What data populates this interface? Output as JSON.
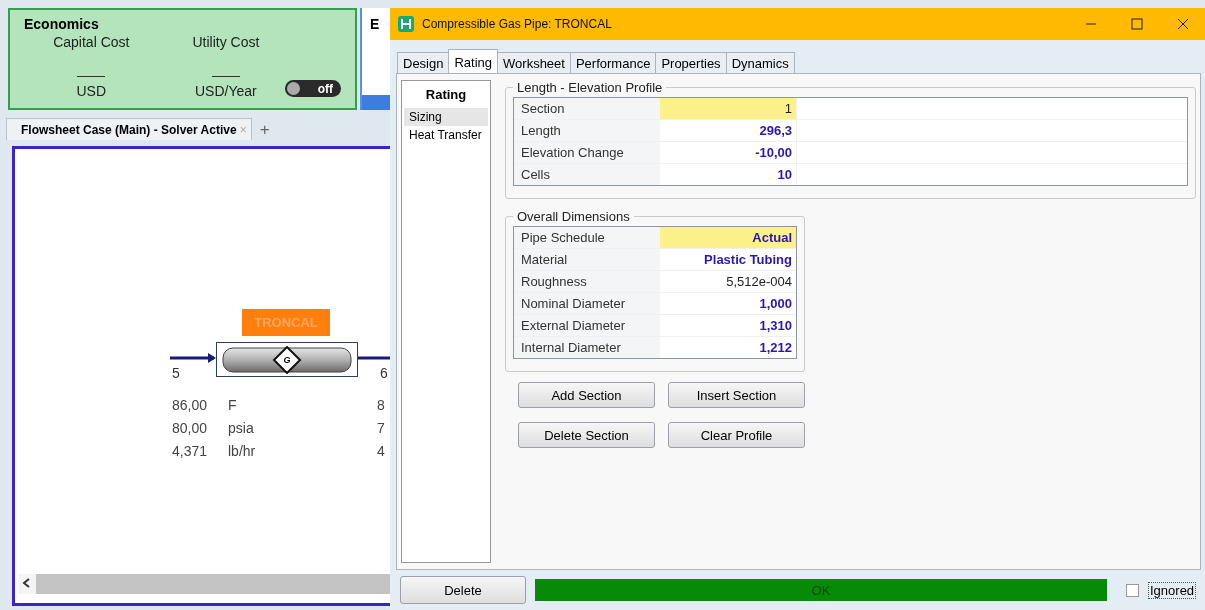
{
  "economics": {
    "title": "Economics",
    "columns": [
      {
        "label": "Capital Cost",
        "unit": "USD"
      },
      {
        "label": "Utility Cost",
        "unit": "USD/Year"
      }
    ],
    "toggle": {
      "label": "off",
      "on": false
    }
  },
  "behind_panel": {
    "title": "E"
  },
  "flowsheet_tab": {
    "label": "Flowsheet Case (Main) - Solver Active",
    "close": "×",
    "add": "+"
  },
  "flowsheet": {
    "unit": {
      "label": "TRONCAL",
      "symbol": "G"
    },
    "inlet": {
      "name": "5",
      "values": [
        {
          "value": "86,00",
          "unit": "F"
        },
        {
          "value": "80,00",
          "unit": "psia"
        },
        {
          "value": "4,371",
          "unit": "lb/hr"
        }
      ]
    },
    "outlet": {
      "name": "6",
      "values": [
        "8",
        "7",
        "4"
      ]
    }
  },
  "dialog": {
    "title": "Compressible Gas Pipe: TRONCAL",
    "tabs": [
      {
        "label": "Design",
        "selected": false
      },
      {
        "label": "Rating",
        "selected": true
      },
      {
        "label": "Worksheet",
        "selected": false
      },
      {
        "label": "Performance",
        "selected": false
      },
      {
        "label": "Properties",
        "selected": false
      },
      {
        "label": "Dynamics",
        "selected": false
      }
    ],
    "nav": {
      "heading": "Rating",
      "items": [
        {
          "label": "Sizing",
          "selected": true
        },
        {
          "label": "Heat Transfer",
          "selected": false
        }
      ]
    },
    "groups": [
      {
        "title": "Length - Elevation Profile",
        "wide": true,
        "rows": [
          {
            "label": "Section",
            "value": "1",
            "specified": false,
            "selected": true
          },
          {
            "label": "Length",
            "value": "296,3",
            "specified": true,
            "selected": false
          },
          {
            "label": "Elevation Change",
            "value": "-10,00",
            "specified": true,
            "selected": false
          },
          {
            "label": "Cells",
            "value": "10",
            "specified": true,
            "selected": false
          }
        ]
      },
      {
        "title": "Overall Dimensions",
        "wide": false,
        "rows": [
          {
            "label": "Pipe Schedule",
            "value": "Actual",
            "specified": true,
            "selected": true
          },
          {
            "label": "Material",
            "value": "Plastic Tubing",
            "specified": true,
            "selected": false
          },
          {
            "label": "Roughness",
            "value": "5,512e-004",
            "specified": false,
            "selected": false
          },
          {
            "label": "Nominal Diameter",
            "value": "1,000",
            "specified": true,
            "selected": false
          },
          {
            "label": "External Diameter",
            "value": "1,310",
            "specified": true,
            "selected": false
          },
          {
            "label": "Internal Diameter",
            "value": "1,212",
            "specified": true,
            "selected": false
          }
        ]
      }
    ],
    "buttons": [
      "Add Section",
      "Insert Section",
      "Delete Section",
      "Clear Profile"
    ],
    "footer": {
      "delete": "Delete",
      "status": {
        "text": "OK",
        "color": "#078a07"
      },
      "ignored": {
        "label": "Ignored",
        "checked": false
      }
    }
  }
}
